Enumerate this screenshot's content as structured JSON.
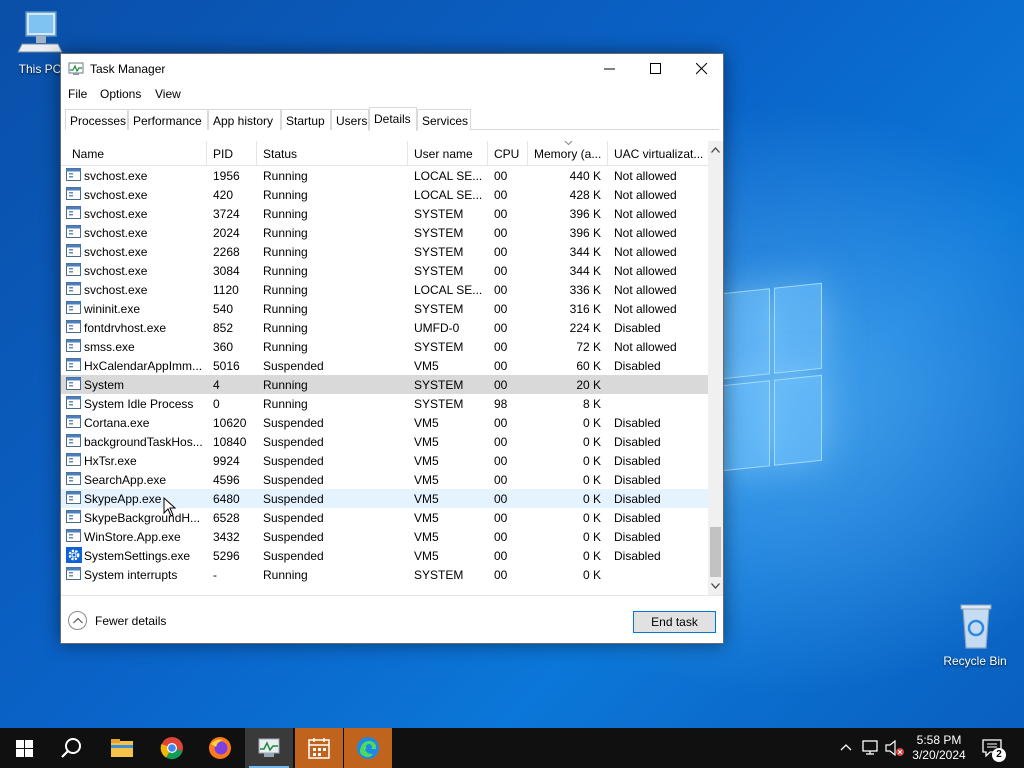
{
  "desktop": {
    "icons": [
      {
        "label": "This PC"
      },
      {
        "label": "Recycle Bin"
      }
    ]
  },
  "window": {
    "title": "Task Manager",
    "menu": [
      "File",
      "Options",
      "View"
    ],
    "tabs": [
      "Processes",
      "Performance",
      "App history",
      "Startup",
      "Users",
      "Details",
      "Services"
    ],
    "active_tab": "Details",
    "columns": [
      "Name",
      "PID",
      "Status",
      "User name",
      "CPU",
      "Memory (a...",
      "UAC virtualizat..."
    ],
    "rows": [
      {
        "name": "svchost.exe",
        "pid": "1956",
        "status": "Running",
        "user": "LOCAL SE...",
        "cpu": "00",
        "memory": "440 K",
        "uac": "Not allowed"
      },
      {
        "name": "svchost.exe",
        "pid": "420",
        "status": "Running",
        "user": "LOCAL SE...",
        "cpu": "00",
        "memory": "428 K",
        "uac": "Not allowed"
      },
      {
        "name": "svchost.exe",
        "pid": "3724",
        "status": "Running",
        "user": "SYSTEM",
        "cpu": "00",
        "memory": "396 K",
        "uac": "Not allowed"
      },
      {
        "name": "svchost.exe",
        "pid": "2024",
        "status": "Running",
        "user": "SYSTEM",
        "cpu": "00",
        "memory": "396 K",
        "uac": "Not allowed"
      },
      {
        "name": "svchost.exe",
        "pid": "2268",
        "status": "Running",
        "user": "SYSTEM",
        "cpu": "00",
        "memory": "344 K",
        "uac": "Not allowed"
      },
      {
        "name": "svchost.exe",
        "pid": "3084",
        "status": "Running",
        "user": "SYSTEM",
        "cpu": "00",
        "memory": "344 K",
        "uac": "Not allowed"
      },
      {
        "name": "svchost.exe",
        "pid": "1120",
        "status": "Running",
        "user": "LOCAL SE...",
        "cpu": "00",
        "memory": "336 K",
        "uac": "Not allowed"
      },
      {
        "name": "wininit.exe",
        "pid": "540",
        "status": "Running",
        "user": "SYSTEM",
        "cpu": "00",
        "memory": "316 K",
        "uac": "Not allowed"
      },
      {
        "name": "fontdrvhost.exe",
        "pid": "852",
        "status": "Running",
        "user": "UMFD-0",
        "cpu": "00",
        "memory": "224 K",
        "uac": "Disabled"
      },
      {
        "name": "smss.exe",
        "pid": "360",
        "status": "Running",
        "user": "SYSTEM",
        "cpu": "00",
        "memory": "72 K",
        "uac": "Not allowed"
      },
      {
        "name": "HxCalendarAppImm...",
        "pid": "5016",
        "status": "Suspended",
        "user": "VM5",
        "cpu": "00",
        "memory": "60 K",
        "uac": "Disabled"
      },
      {
        "name": "System",
        "pid": "4",
        "status": "Running",
        "user": "SYSTEM",
        "cpu": "00",
        "memory": "20 K",
        "uac": "",
        "selected": true
      },
      {
        "name": "System Idle Process",
        "pid": "0",
        "status": "Running",
        "user": "SYSTEM",
        "cpu": "98",
        "memory": "8 K",
        "uac": ""
      },
      {
        "name": "Cortana.exe",
        "pid": "10620",
        "status": "Suspended",
        "user": "VM5",
        "cpu": "00",
        "memory": "0 K",
        "uac": "Disabled"
      },
      {
        "name": "backgroundTaskHos...",
        "pid": "10840",
        "status": "Suspended",
        "user": "VM5",
        "cpu": "00",
        "memory": "0 K",
        "uac": "Disabled"
      },
      {
        "name": "HxTsr.exe",
        "pid": "9924",
        "status": "Suspended",
        "user": "VM5",
        "cpu": "00",
        "memory": "0 K",
        "uac": "Disabled"
      },
      {
        "name": "SearchApp.exe",
        "pid": "4596",
        "status": "Suspended",
        "user": "VM5",
        "cpu": "00",
        "memory": "0 K",
        "uac": "Disabled"
      },
      {
        "name": "SkypeApp.exe",
        "pid": "6480",
        "status": "Suspended",
        "user": "VM5",
        "cpu": "00",
        "memory": "0 K",
        "uac": "Disabled",
        "hover": true
      },
      {
        "name": "SkypeBackgroundH...",
        "pid": "6528",
        "status": "Suspended",
        "user": "VM5",
        "cpu": "00",
        "memory": "0 K",
        "uac": "Disabled"
      },
      {
        "name": "WinStore.App.exe",
        "pid": "3432",
        "status": "Suspended",
        "user": "VM5",
        "cpu": "00",
        "memory": "0 K",
        "uac": "Disabled"
      },
      {
        "name": "SystemSettings.exe",
        "pid": "5296",
        "status": "Suspended",
        "user": "VM5",
        "cpu": "00",
        "memory": "0 K",
        "uac": "Disabled",
        "icon": "gear-icon"
      },
      {
        "name": "System interrupts",
        "pid": "-",
        "status": "Running",
        "user": "SYSTEM",
        "cpu": "00",
        "memory": "0 K",
        "uac": ""
      }
    ],
    "footer": {
      "fewer_details": "Fewer details",
      "end_task": "End task"
    }
  },
  "taskbar": {
    "apps": [
      "start-icon",
      "search-icon",
      "file-explorer-icon",
      "chrome-icon",
      "firefox-icon",
      "task-manager-icon",
      "calendar-icon",
      "edge-icon"
    ],
    "clock": {
      "time": "5:58 PM",
      "date": "3/20/2024"
    },
    "notification_count": "2"
  },
  "colors": {
    "selected_row": "#d9d9d9",
    "hover_row": "#e5f3ff",
    "accent": "#0078d7",
    "taskbar": "#101010"
  }
}
